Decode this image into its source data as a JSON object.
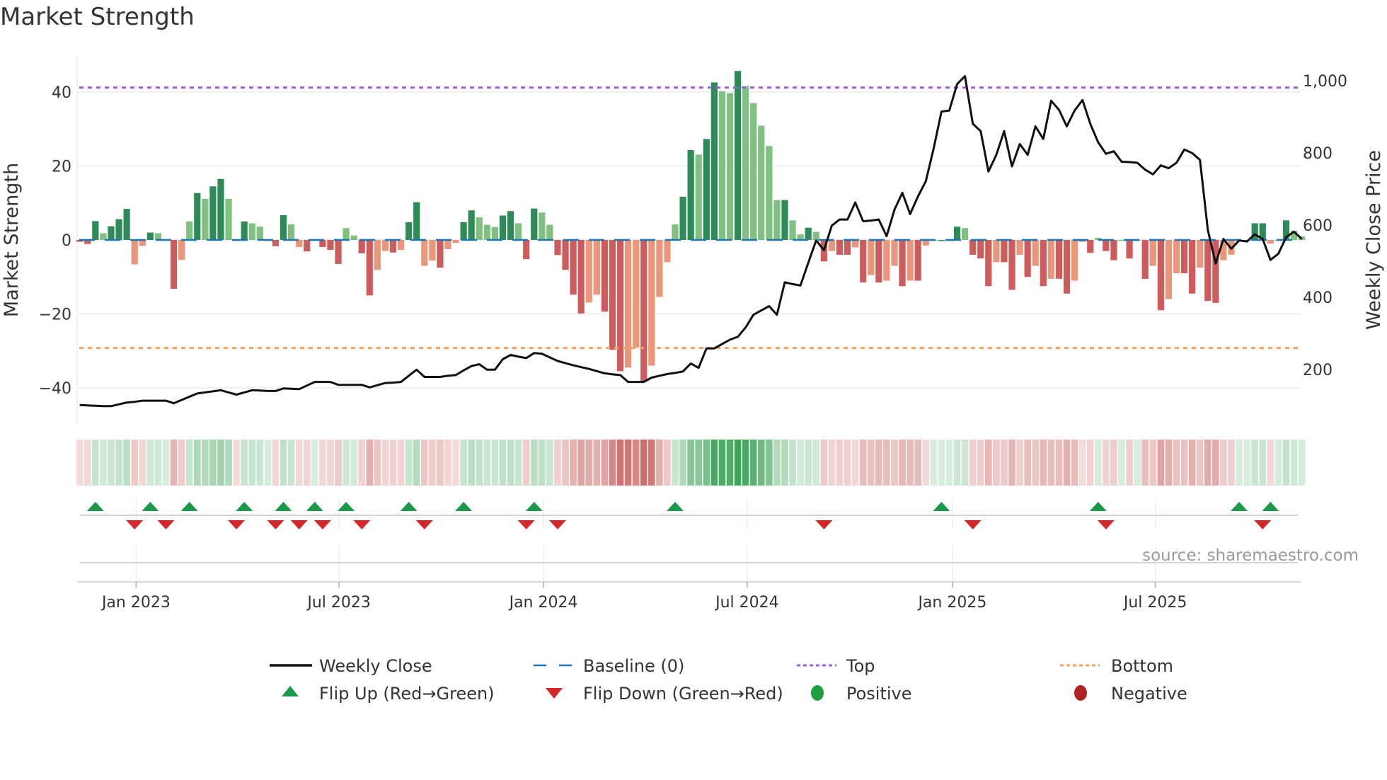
{
  "title": "Market Strength",
  "source": "source: sharemaestro.com",
  "colors": {
    "pos_strong": "#2e8b57",
    "pos_weak": "#80c080",
    "neg_strong": "#cd5c5c",
    "neg_weak": "#e9967a",
    "baseline": "#1f77b4",
    "top": "#9b5fe0",
    "bottom": "#f4a261",
    "close": "#111111",
    "flip_up": "#1a9a48",
    "flip_down": "#d62728",
    "positive": "#1e9e3e",
    "negative": "#b22222"
  },
  "chart_data": {
    "type": "bar",
    "title": "Market Strength",
    "ylabel": "Market Strength",
    "y2label": "Weekly Close Price",
    "ylim": [
      -49,
      49
    ],
    "y2lim": [
      60,
      1100
    ],
    "yticks": [
      "40",
      "20",
      "0",
      "−20",
      "−40"
    ],
    "ytick_values": [
      40,
      20,
      0,
      -20,
      -40
    ],
    "y2ticks": [
      "1,000",
      "800",
      "600",
      "400",
      "200"
    ],
    "y2tick_values": [
      1000,
      800,
      600,
      400,
      200
    ],
    "xticks": [
      "Jan 2023",
      "Jul 2023",
      "Jan 2024",
      "Jul 2024",
      "Jan 2025",
      "Jul 2025"
    ],
    "xtick_week_index": [
      7.2,
      33.1,
      59.2,
      85.2,
      111.4,
      137.3
    ],
    "top_level": 41.2,
    "bottom_level": -29.2,
    "baseline_level": 0,
    "strength": [
      -0.5,
      -1.1,
      5.1,
      1.8,
      3.7,
      5.6,
      8.4,
      -6.6,
      -1.6,
      2.0,
      1.8,
      0,
      -13.2,
      -5.4,
      5.0,
      12.7,
      11.1,
      14.5,
      16.5,
      11.1,
      -0.3,
      5.0,
      4.5,
      3.6,
      0,
      -1.7,
      6.7,
      4.2,
      -1.9,
      -3.1,
      0,
      -1.9,
      -2.7,
      -6.5,
      3.2,
      1.2,
      -3.6,
      -15,
      -8.1,
      -3.0,
      -3.4,
      -2.7,
      4.8,
      10.2,
      -7.0,
      -5.6,
      -7.5,
      -2.5,
      -0.8,
      4.8,
      8.0,
      6.1,
      4.1,
      3.5,
      6.6,
      7.8,
      4.5,
      -5.2,
      8.5,
      7.4,
      4.1,
      -4.1,
      -8.1,
      -14.8,
      -19.9,
      -16.9,
      -14.8,
      -19.4,
      -29.7,
      -35.5,
      -34.5,
      -29.1,
      -38.2,
      -34.0,
      -15.4,
      -6.0,
      4.2,
      11.7,
      24.3,
      23.1,
      27.3,
      42.6,
      40.2,
      39.7,
      45.7,
      41.6,
      37.0,
      30.9,
      25.4,
      10.8,
      10.8,
      5.3,
      1.5,
      3.3,
      2.2,
      -5.8,
      -3.0,
      -4.0,
      -4.0,
      -2.0,
      -11.5,
      -9.5,
      -11.5,
      -11.0,
      -7.0,
      -12.5,
      -11.0,
      -11.0,
      -1.5,
      0,
      0,
      0,
      3.6,
      3.2,
      -4.0,
      -5.0,
      -12.5,
      -6.0,
      -6.0,
      -13.5,
      -4.0,
      -10.0,
      -7.0,
      -12.5,
      -10.5,
      -10.5,
      -14.5,
      -11.0,
      -0.5,
      -3.5,
      0.6,
      -3.0,
      -5.5,
      0,
      -5.0,
      0,
      -10.5,
      -7.0,
      -19.0,
      -16.0,
      -9.0,
      -9.0,
      -14.5,
      -7.5,
      -16.5,
      -17.0,
      -5.5,
      -4.0,
      0,
      0,
      4.5,
      4.5,
      -1.0,
      0,
      5.3,
      2.5,
      1.0
    ],
    "weekly_close": [
      101,
      100,
      99,
      98,
      98,
      103,
      108,
      110,
      113,
      113,
      113,
      113,
      106,
      115,
      124,
      133,
      136,
      139,
      142,
      136,
      130,
      136,
      142,
      141,
      140,
      140,
      147,
      146,
      145,
      155,
      165,
      165,
      165,
      157,
      157,
      157,
      157,
      150,
      156,
      162,
      163,
      165,
      182,
      199,
      179,
      179,
      179,
      182,
      184,
      197,
      209,
      214,
      199,
      199,
      228,
      240,
      235,
      231,
      245,
      243,
      233,
      223,
      217,
      211,
      206,
      201,
      195,
      189,
      186,
      184,
      165,
      165,
      165,
      177,
      182,
      187,
      190,
      194,
      216,
      204,
      258,
      258,
      270,
      282,
      290,
      316,
      351,
      363,
      375,
      351,
      441,
      436,
      432,
      495,
      557,
      530,
      598,
      615,
      615,
      662,
      610,
      612,
      615,
      569,
      642,
      689,
      630,
      679,
      721,
      811,
      914,
      917,
      990,
      1012,
      880,
      860,
      748,
      794,
      860,
      762,
      824,
      794,
      873,
      838,
      944,
      919,
      873,
      917,
      946,
      880,
      829,
      797,
      804,
      775,
      774,
      772,
      753,
      740,
      765,
      757,
      772,
      809,
      799,
      780,
      586,
      493,
      561,
      534,
      557,
      554,
      574,
      561,
      503,
      520,
      566,
      581,
      561
    ],
    "flip_up_weeks": [
      2,
      9,
      14,
      21,
      26,
      30,
      34,
      42,
      49,
      58,
      76,
      110,
      130,
      148,
      152
    ],
    "flip_down_weeks": [
      7,
      11,
      20,
      25,
      28,
      31,
      36,
      44,
      57,
      61,
      95,
      114,
      131,
      151
    ],
    "legend": {
      "placement": "bottom",
      "items": [
        {
          "label": "Weekly Close",
          "symbol": "line"
        },
        {
          "label": "Baseline (0)",
          "symbol": "dash"
        },
        {
          "label": "Top",
          "symbol": "dot-purple"
        },
        {
          "label": "Bottom",
          "symbol": "dot-orange"
        },
        {
          "label": "Flip Up (Red→Green)",
          "symbol": "triangle-up"
        },
        {
          "label": "Flip Down (Green→Red)",
          "symbol": "triangle-down"
        },
        {
          "label": "Positive",
          "symbol": "circle-green"
        },
        {
          "label": "Negative",
          "symbol": "circle-red"
        }
      ]
    }
  }
}
